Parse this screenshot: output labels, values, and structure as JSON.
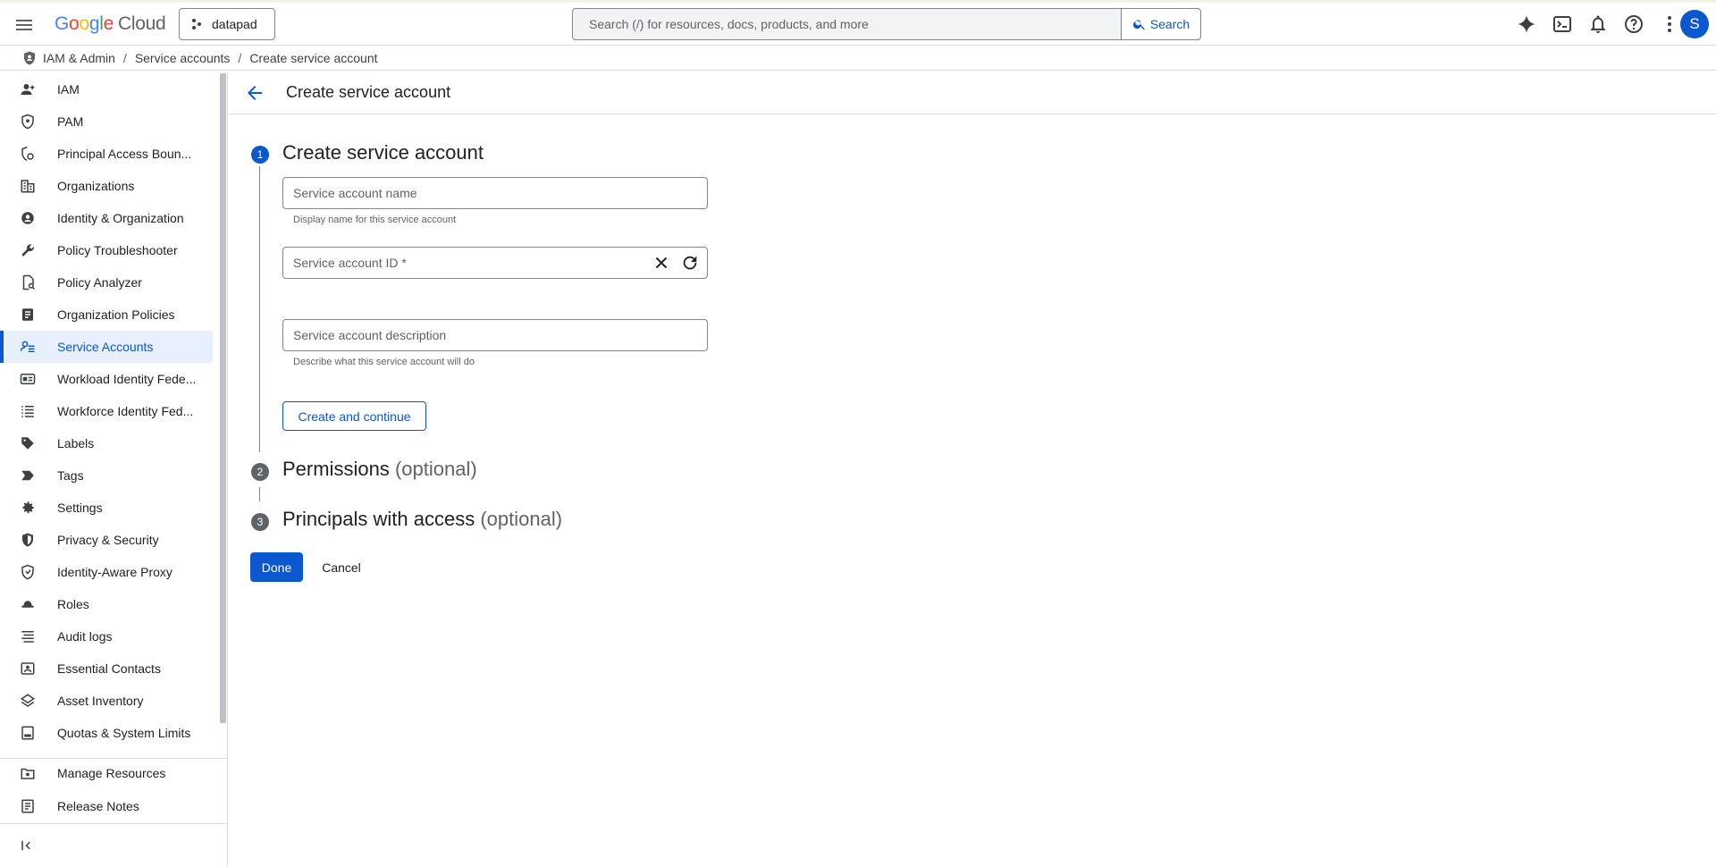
{
  "header": {
    "logo_google": "Google",
    "logo_cloud": "Cloud",
    "project_name": "datapad",
    "search_placeholder": "Search (/) for resources, docs, products, and more",
    "search_button": "Search",
    "avatar_initial": "S"
  },
  "breadcrumb": {
    "items": [
      "IAM & Admin",
      "Service accounts",
      "Create service account"
    ],
    "separator": "/"
  },
  "sidebar": {
    "items": [
      {
        "label": "IAM",
        "icon": "person-add-icon"
      },
      {
        "label": "PAM",
        "icon": "shield-icon"
      },
      {
        "label": "Principal Access Boun...",
        "icon": "policy-shield-icon"
      },
      {
        "label": "Organizations",
        "icon": "building-icon"
      },
      {
        "label": "Identity & Organization",
        "icon": "account-circle-icon"
      },
      {
        "label": "Policy Troubleshooter",
        "icon": "wrench-icon"
      },
      {
        "label": "Policy Analyzer",
        "icon": "document-search-icon"
      },
      {
        "label": "Organization Policies",
        "icon": "list-document-icon"
      },
      {
        "label": "Service Accounts",
        "icon": "service-account-icon"
      },
      {
        "label": "Workload Identity Fede...",
        "icon": "id-card-icon"
      },
      {
        "label": "Workforce Identity Fed...",
        "icon": "list-icon"
      },
      {
        "label": "Labels",
        "icon": "tag-icon"
      },
      {
        "label": "Tags",
        "icon": "label-arrow-icon"
      },
      {
        "label": "Settings",
        "icon": "gear-icon"
      },
      {
        "label": "Privacy & Security",
        "icon": "security-shield-icon"
      },
      {
        "label": "Identity-Aware Proxy",
        "icon": "proxy-icon"
      },
      {
        "label": "Roles",
        "icon": "hat-icon"
      },
      {
        "label": "Audit logs",
        "icon": "lines-icon"
      },
      {
        "label": "Essential Contacts",
        "icon": "contact-card-icon"
      },
      {
        "label": "Asset Inventory",
        "icon": "diamond-stack-icon"
      },
      {
        "label": "Quotas & System Limits",
        "icon": "calendar-icon"
      }
    ],
    "active_index": 8,
    "bottom_items": [
      {
        "label": "Manage Resources",
        "icon": "folder-gear-icon"
      },
      {
        "label": "Release Notes",
        "icon": "notes-icon"
      }
    ],
    "accent_color": "#0b57d0",
    "active_bg": "#e8f0fe"
  },
  "page": {
    "title": "Create service account"
  },
  "steps": [
    {
      "number": "1",
      "title": "Create service account",
      "optional": ""
    },
    {
      "number": "2",
      "title": "Permissions",
      "optional": "(optional)"
    },
    {
      "number": "3",
      "title": "Principals with access",
      "optional": "(optional)"
    }
  ],
  "form": {
    "name_placeholder": "Service account name",
    "name_value": "",
    "name_hint": "Display name for this service account",
    "id_placeholder": "Service account ID *",
    "id_value": "",
    "description_placeholder": "Service account description",
    "description_value": "",
    "description_hint": "Describe what this service account will do",
    "create_button": "Create and continue"
  },
  "actions": {
    "done": "Done",
    "cancel": "Cancel"
  }
}
